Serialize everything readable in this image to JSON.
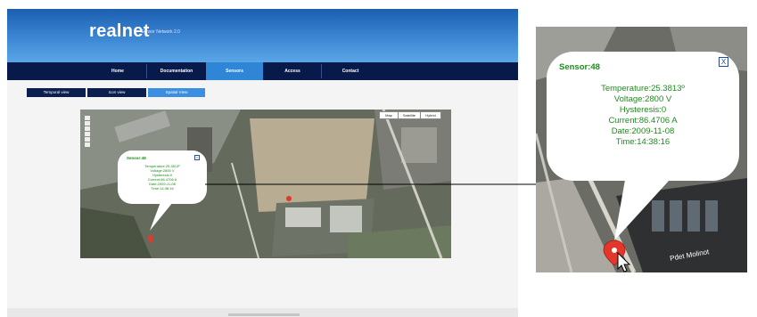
{
  "app": {
    "logo": "realnet",
    "logo_sub": "Sensor Network 2.0",
    "nav": [
      {
        "label": "Home",
        "active": false
      },
      {
        "label": "Documentation",
        "active": false
      },
      {
        "label": "Sensors",
        "active": true
      },
      {
        "label": "Access",
        "active": false
      },
      {
        "label": "Contact",
        "active": false
      }
    ],
    "subtabs": [
      {
        "label": "Temporal view",
        "active": false
      },
      {
        "label": "Icon view",
        "active": false
      },
      {
        "label": "Spatial View",
        "active": true
      }
    ],
    "map_buttons": [
      "Map",
      "Satellite",
      "Hybrid"
    ]
  },
  "popup": {
    "title": "Sensor:48",
    "lines": [
      "Temperature:25.3813º",
      "Voltage:2800 V",
      "Hysteresis:0",
      "Current:86.4706 A",
      "Date:2009-11-08",
      "Time:14:38:16"
    ],
    "close": "X"
  },
  "zoom_street_label": "Pdet Molinot"
}
